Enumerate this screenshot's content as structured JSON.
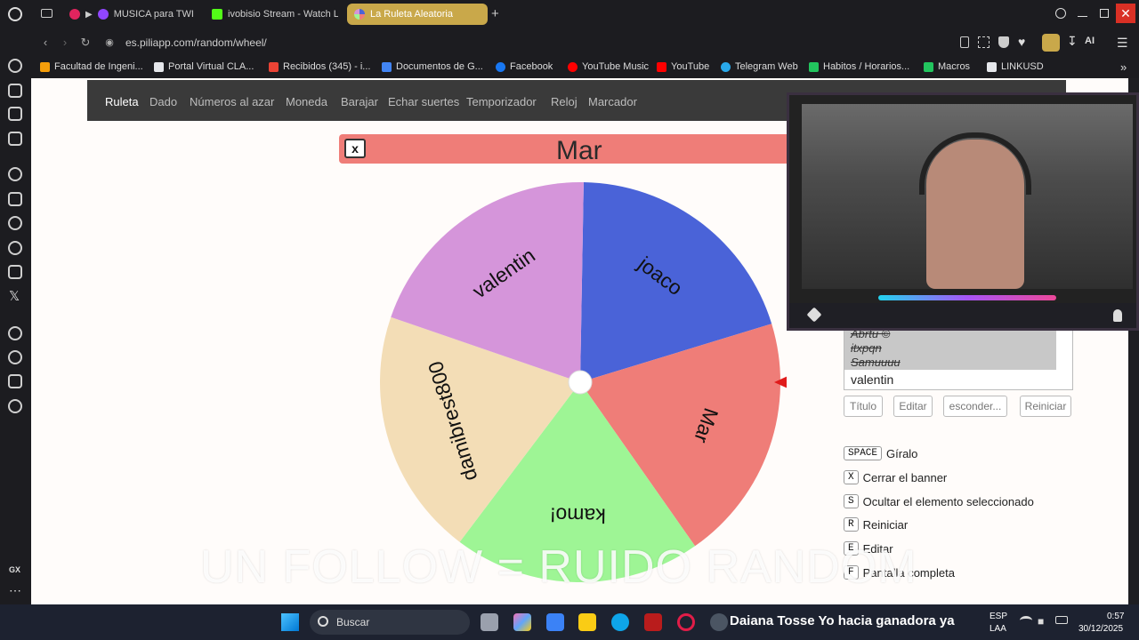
{
  "tabs": [
    {
      "label": "MUSICA para TWIT",
      "color": "#e0245e"
    },
    {
      "label": "ivobisio Stream - Watch L",
      "color": "#53fc18"
    },
    {
      "label": "La Ruleta Aleatoria",
      "color": "#a78bfa"
    }
  ],
  "address": {
    "url": "es.piliapp.com/random/wheel/"
  },
  "bookmarks": [
    {
      "label": "Facultad de Ingeni...",
      "color": "#f59e0b"
    },
    {
      "label": "Portal Virtual CLA...",
      "color": "#e5e7eb"
    },
    {
      "label": "Recibidos (345) - i...",
      "color": "#ea4335"
    },
    {
      "label": "Documentos de G...",
      "color": "#4285f4"
    },
    {
      "label": "Facebook",
      "color": "#1877f2"
    },
    {
      "label": "YouTube Music",
      "color": "#ff0000"
    },
    {
      "label": "YouTube",
      "color": "#ff0000"
    },
    {
      "label": "Telegram Web",
      "color": "#29a9eb"
    },
    {
      "label": "Habitos / Horarios...",
      "color": "#22c55e"
    },
    {
      "label": "Macros",
      "color": "#22c55e"
    },
    {
      "label": "LINKUSD",
      "color": "#e5e7eb"
    }
  ],
  "sitenav": {
    "items": [
      "Ruleta",
      "Dado",
      "Números al azar",
      "Moneda",
      "Barajar",
      "Echar suertes",
      "Temporizador",
      "Reloj",
      "Marcador"
    ]
  },
  "banner": {
    "close_label": "x",
    "title": "Mar",
    "color": "#ef7d78"
  },
  "wheel": {
    "segments": [
      {
        "label": "joaco",
        "color": "#4a63d8"
      },
      {
        "label": "Mar",
        "color": "#ef7d78"
      },
      {
        "label": "kamo!",
        "color": "#9ef595"
      },
      {
        "label": "damibrest800",
        "color": "#f3ddb6"
      },
      {
        "label": "valentin",
        "color": "#d595da"
      }
    ],
    "pointer_color": "#e01b1b"
  },
  "list": {
    "struck": [
      "Abrtu ©",
      "itxpqn",
      "Samuuuu"
    ],
    "active": "valentin"
  },
  "buttons": {
    "title": "Título",
    "edit": "Editar",
    "hide": "esconder...",
    "reset": "Reiniciar"
  },
  "shortcuts": [
    {
      "key": "SPACE",
      "label": "Gíralo"
    },
    {
      "key": "X",
      "label": "Cerrar el banner"
    },
    {
      "key": "S",
      "label": "Ocultar el elemento seleccionado"
    },
    {
      "key": "R",
      "label": "Reiniciar"
    },
    {
      "key": "E",
      "label": "Editar"
    },
    {
      "key": "F",
      "label": "Pantalla completa"
    }
  ],
  "overlay": {
    "text": "UN FOLLOW = RUIDO RANDOM"
  },
  "taskbar": {
    "search_placeholder": "Buscar",
    "ticker": "Daiana Tosse  Yo  hacia ganadora ya",
    "lang": "ESP",
    "lang2": "LAA",
    "time": "0:57",
    "date": "30/12/2025"
  }
}
